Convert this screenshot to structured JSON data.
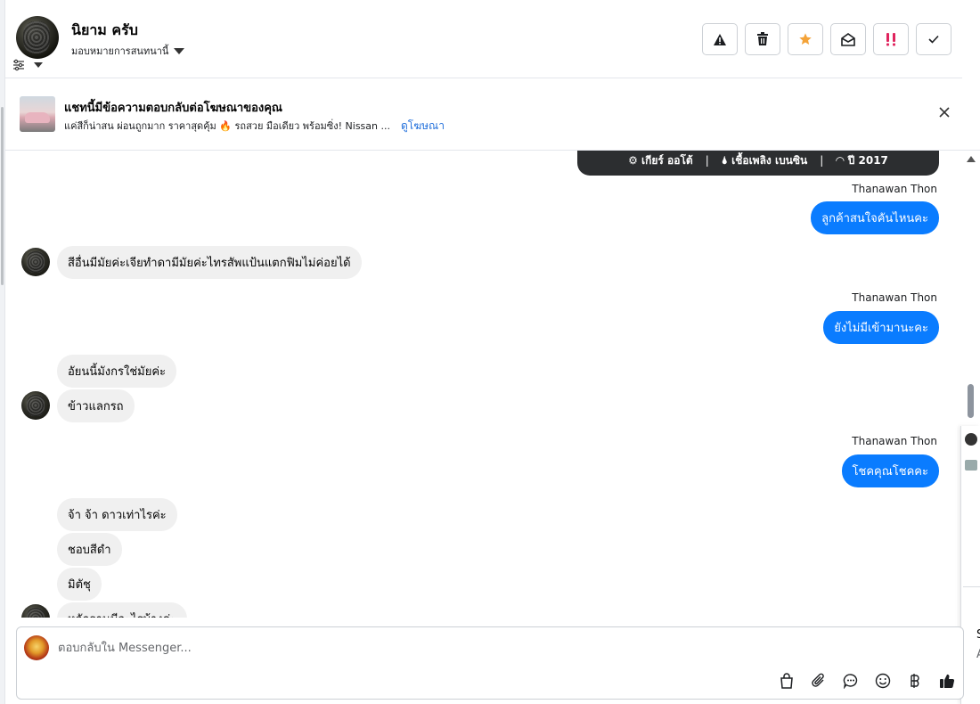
{
  "header": {
    "contact_name": "นิยาม ครับ",
    "assign_label": "มอบหมายการสนทนานี้",
    "buttons": [
      {
        "name": "spam-button",
        "icon": "warning-icon"
      },
      {
        "name": "delete-button",
        "icon": "trash-icon"
      },
      {
        "name": "star-button",
        "icon": "star-icon",
        "color": "#f4a338"
      },
      {
        "name": "mark-unread-button",
        "icon": "envelope-open-icon"
      },
      {
        "name": "follow-up-button",
        "icon": "exclamation-icon",
        "color": "#e0245e"
      },
      {
        "name": "mark-done-button",
        "icon": "check-icon"
      }
    ]
  },
  "ad_banner": {
    "title": "แชทนี้มีข้อความตอบกลับต่อโฆษณาของคุณ",
    "subtitle": "แค่สีก็น่าสน ผ่อนถูกมาก ราคาสุดคุ้ม 🔥 รถสวย มือเดียว พร้อมซิ่ง! Nissan ...",
    "link": "ดูโฆษณา"
  },
  "spec_card": {
    "gear": "⚙ เกียร์ ออโต้",
    "fuel": "🌢 เชื้อเพลิง เบนซิน",
    "year": "◠ ปี 2017",
    "separator": "|"
  },
  "messages": {
    "sender_1": "Thanawan Thon",
    "out_1": "ลูกค้าสนใจคันไหนคะ",
    "in_1": "สีอื่นมีมัยค่ะเจียทำดามีมัยค่ะไทรสัพแป้นแตกฟิมไม่ค่อยได้",
    "sender_2": "Thanawan Thon",
    "out_2": "ยังไม่มีเข้ามานะคะ",
    "in_2": "อัยนนี้มังกรใช่มัยค่ะ",
    "in_3": "ข้าวแลกรถ",
    "sender_3": "Thanawan Thon",
    "out_3": "โชคคุณโชคคะ",
    "in_4": "จ้า จ้า ดาวเท่าไรค่ะ",
    "in_5": "ชอบสีดำ",
    "in_6": "มิตัชุ",
    "in_7": "หลักฐานมีอะไรบ้างค่ะ"
  },
  "side_panel": {
    "letter_s": "S",
    "letter_a": "A"
  },
  "composer": {
    "placeholder": "ตอบกลับใน Messenger...",
    "tools": [
      "shopping-bag-icon",
      "paperclip-icon",
      "saved-reply-icon",
      "emoji-icon",
      "baht-icon",
      "thumbs-up-icon"
    ]
  },
  "colors": {
    "accent_blue": "#0a7cff",
    "link_blue": "#216fdb",
    "incoming_bubble": "#f0f0f0",
    "spec_card_bg": "#2c2e30"
  }
}
